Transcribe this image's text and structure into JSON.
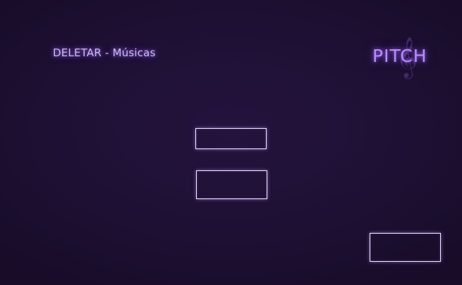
{
  "header": {
    "title": "DELETAR - Músicas"
  },
  "logo": {
    "text": "PITCH",
    "icon": "treble-clef-icon"
  },
  "buttons": {
    "first_label": "",
    "second_label": "",
    "corner_label": ""
  },
  "colors": {
    "background": "#1f1136",
    "accent": "#b98cff",
    "title": "#cdb8f5",
    "button_border": "#f2eaff"
  }
}
